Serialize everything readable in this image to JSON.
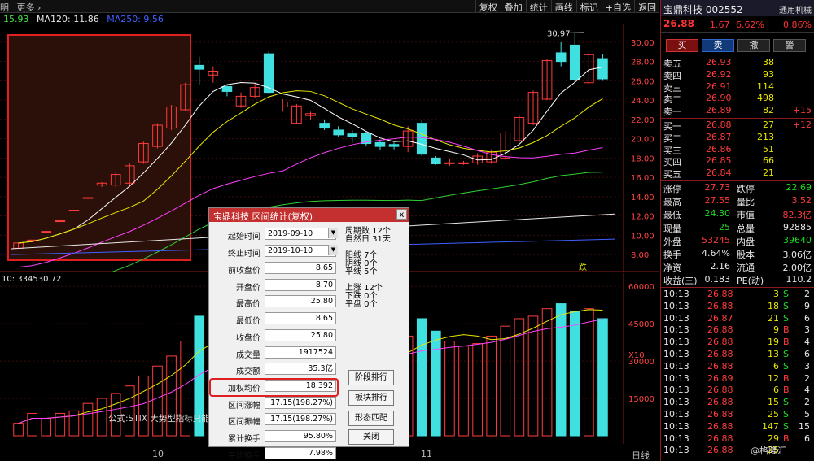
{
  "topbar": {
    "left": [
      "明",
      "更多 ›"
    ],
    "buttons": [
      "复权",
      "叠加",
      "统计",
      "画线",
      "标记",
      "+自选",
      "返回"
    ]
  },
  "ma_legend": [
    {
      "text": "15.93",
      "color": "#3fe03f"
    },
    {
      "text": "MA120: 11.86",
      "color": "#e8e8e8"
    },
    {
      "text": "MA250: 9.56",
      "color": "#4060ff"
    }
  ],
  "price_axis": [
    "30.00",
    "28.00",
    "26.00",
    "24.00",
    "22.00",
    "20.00",
    "18.00",
    "16.00",
    "14.00",
    "12.00",
    "10.00",
    "8.00"
  ],
  "price_annotation": "30.97",
  "vol_label": "10: 334530.72",
  "vol_axis": [
    "60000",
    "45000",
    "30000",
    "15000",
    "X10"
  ],
  "up_marker": "跌",
  "bottom_axis": {
    "left": "10",
    "mid": "11",
    "right": "日线"
  },
  "chart_data": {
    "type": "candlestick",
    "candles": [
      {
        "o": 8.65,
        "c": 9.2,
        "h": 9.2,
        "l": 8.65
      },
      {
        "o": 9.5,
        "c": 9.5,
        "h": 9.5,
        "l": 9.5
      },
      {
        "o": 10.4,
        "c": 10.4,
        "h": 10.4,
        "l": 10.4
      },
      {
        "o": 11.5,
        "c": 11.5,
        "h": 11.5,
        "l": 11.5
      },
      {
        "o": 12.6,
        "c": 12.6,
        "h": 12.6,
        "l": 12.6
      },
      {
        "o": 13.9,
        "c": 13.9,
        "h": 13.9,
        "l": 13.9
      },
      {
        "o": 15.2,
        "c": 15.4,
        "h": 15.5,
        "l": 15.0
      },
      {
        "o": 15.2,
        "c": 16.3,
        "h": 16.5,
        "l": 15.0
      },
      {
        "o": 15.4,
        "c": 17.2,
        "h": 17.5,
        "l": 15.0
      },
      {
        "o": 17.6,
        "c": 19.5,
        "h": 19.7,
        "l": 17.4
      },
      {
        "o": 19.2,
        "c": 21.4,
        "h": 21.6,
        "l": 19.0
      },
      {
        "o": 21.1,
        "c": 23.3,
        "h": 23.5,
        "l": 20.9
      },
      {
        "o": 23.0,
        "c": 25.6,
        "h": 25.8,
        "l": 22.9
      },
      {
        "o": 27.6,
        "c": 27.2,
        "h": 28.5,
        "l": 25.6
      },
      {
        "o": 26.6,
        "c": 27.0,
        "h": 27.5,
        "l": 25.8
      },
      {
        "o": 25.4,
        "c": 24.9,
        "h": 25.6,
        "l": 24.4
      },
      {
        "o": 23.4,
        "c": 24.4,
        "h": 24.8,
        "l": 23.2
      },
      {
        "o": 24.4,
        "c": 25.3,
        "h": 25.7,
        "l": 24.2
      },
      {
        "o": 28.8,
        "c": 24.8,
        "h": 29.0,
        "l": 24.6
      },
      {
        "o": 23.3,
        "c": 23.8,
        "h": 24.1,
        "l": 22.8
      },
      {
        "o": 21.6,
        "c": 23.4,
        "h": 23.6,
        "l": 21.5
      },
      {
        "o": 22.4,
        "c": 22.6,
        "h": 22.8,
        "l": 22.0
      },
      {
        "o": 21.6,
        "c": 21.1,
        "h": 22.0,
        "l": 20.9
      },
      {
        "o": 20.9,
        "c": 20.4,
        "h": 21.3,
        "l": 20.2
      },
      {
        "o": 20.5,
        "c": 20.2,
        "h": 20.9,
        "l": 19.6
      },
      {
        "o": 20.6,
        "c": 19.5,
        "h": 20.8,
        "l": 19.2
      },
      {
        "o": 19.6,
        "c": 19.2,
        "h": 19.9,
        "l": 18.8
      },
      {
        "o": 19.4,
        "c": 19.2,
        "h": 19.6,
        "l": 18.9
      },
      {
        "o": 19.2,
        "c": 20.8,
        "h": 21.3,
        "l": 18.6
      },
      {
        "o": 21.6,
        "c": 18.4,
        "h": 22.0,
        "l": 18.2
      },
      {
        "o": 18.0,
        "c": 17.4,
        "h": 18.2,
        "l": 17.3
      },
      {
        "o": 17.5,
        "c": 17.5,
        "h": 17.9,
        "l": 17.2
      },
      {
        "o": 17.4,
        "c": 17.5,
        "h": 17.7,
        "l": 17.3
      },
      {
        "o": 17.5,
        "c": 18.2,
        "h": 18.5,
        "l": 17.3
      },
      {
        "o": 17.6,
        "c": 18.6,
        "h": 18.9,
        "l": 17.4
      },
      {
        "o": 18.0,
        "c": 20.6,
        "h": 20.8,
        "l": 17.8
      },
      {
        "o": 19.8,
        "c": 22.2,
        "h": 22.4,
        "l": 19.6
      },
      {
        "o": 21.6,
        "c": 24.8,
        "h": 25.0,
        "l": 21.4
      },
      {
        "o": 24.1,
        "c": 28.1,
        "h": 28.3,
        "l": 24.0
      },
      {
        "o": 28.9,
        "c": 28.0,
        "h": 30.0,
        "l": 27.5
      },
      {
        "o": 29.7,
        "c": 26.1,
        "h": 30.97,
        "l": 25.8
      },
      {
        "o": 25.8,
        "c": 28.7,
        "h": 29.0,
        "l": 25.5
      },
      {
        "o": 28.3,
        "c": 26.2,
        "h": 28.8,
        "l": 26.0
      }
    ],
    "volume": [
      5000,
      9000,
      7000,
      9000,
      10000,
      13000,
      15000,
      17000,
      20000,
      24000,
      28000,
      32000,
      38000,
      48000,
      40000,
      42000,
      38000,
      36000,
      46000,
      34000,
      36000,
      30000,
      31000,
      30000,
      32000,
      32000,
      31000,
      32000,
      40000,
      47000,
      42000,
      38000,
      36000,
      37000,
      40000,
      44000,
      47000,
      48000,
      51000,
      53000,
      50000,
      51000,
      47000
    ],
    "ylim": [
      7.0,
      31.0
    ],
    "vol_ylim": [
      0,
      62000
    ]
  },
  "dialog": {
    "title": "宝鼎科技 区间统计(复权)",
    "close": "x",
    "start_label": "起始时间",
    "start": "2019-09-10",
    "end_label": "终止时间",
    "end": "2019-10-10",
    "rows": [
      {
        "label": "前收盘价",
        "value": "8.65"
      },
      {
        "label": "开盘价",
        "value": "8.70"
      },
      {
        "label": "最高价",
        "value": "25.80"
      },
      {
        "label": "最低价",
        "value": "8.65"
      },
      {
        "label": "收盘价",
        "value": "25.80"
      },
      {
        "label": "成交量",
        "value": "1917524"
      },
      {
        "label": "成交额",
        "value": "35.3亿"
      },
      {
        "label": "加权均价",
        "value": "18.392"
      },
      {
        "label": "区间涨幅",
        "value": "17.15(198.27%)"
      },
      {
        "label": "区间振幅",
        "value": "17.15(198.27%)"
      },
      {
        "label": "累计换手",
        "value": "95.80%"
      },
      {
        "label": "平均换手",
        "value": "7.98%"
      }
    ],
    "stats": [
      "周期数 12个",
      "自然日 31天",
      "阳线 7个",
      "阴线 0个",
      "平线 5个",
      "上涨 12个",
      "下跌 0个",
      "平盘 0个"
    ],
    "buttons": [
      "阶段排行",
      "板块排行",
      "形态匹配",
      "关闭"
    ]
  },
  "formula": "公式:STIX 大势型指标只能用",
  "right": {
    "name": "宝鼎科技 002552",
    "sector": "通用机械",
    "price": "26.88",
    "change": "1.67",
    "pct": "6.62%",
    "other_pct": "0.86%",
    "trade_buttons": [
      "买",
      "卖",
      "撤",
      "警"
    ],
    "asks": [
      {
        "l": "卖五",
        "p": "26.93",
        "v": "38",
        "d": ""
      },
      {
        "l": "卖四",
        "p": "26.92",
        "v": "93",
        "d": ""
      },
      {
        "l": "卖三",
        "p": "26.91",
        "v": "114",
        "d": ""
      },
      {
        "l": "卖二",
        "p": "26.90",
        "v": "498",
        "d": ""
      },
      {
        "l": "卖一",
        "p": "26.89",
        "v": "82",
        "d": "+15"
      }
    ],
    "bids": [
      {
        "l": "买一",
        "p": "26.88",
        "v": "27",
        "d": "+12"
      },
      {
        "l": "买二",
        "p": "26.87",
        "v": "213",
        "d": ""
      },
      {
        "l": "买三",
        "p": "26.86",
        "v": "51",
        "d": ""
      },
      {
        "l": "买四",
        "p": "26.85",
        "v": "66",
        "d": ""
      },
      {
        "l": "买五",
        "p": "26.84",
        "v": "21",
        "d": ""
      }
    ],
    "quote": [
      [
        "涨停",
        "27.73",
        "跌停",
        "22.69"
      ],
      [
        "最高",
        "27.55",
        "量比",
        "3.52"
      ],
      [
        "最低",
        "24.30",
        "市值",
        "82.3亿"
      ],
      [
        "现量",
        "25",
        "总量",
        "92885"
      ],
      [
        "外盘",
        "53245",
        "内盘",
        "39640"
      ],
      [
        "换手",
        "4.64%",
        "股本",
        "3.06亿"
      ],
      [
        "净资",
        "2.16",
        "流通",
        "2.00亿"
      ],
      [
        "收益(三)",
        "0.183",
        "PE(动)",
        "110.2"
      ]
    ],
    "ticks": [
      [
        "10:13",
        "26.88",
        "3",
        "S",
        "2"
      ],
      [
        "10:13",
        "26.88",
        "18",
        "S",
        "9"
      ],
      [
        "10:13",
        "26.87",
        "21",
        "S",
        "6"
      ],
      [
        "10:13",
        "26.88",
        "9",
        "B",
        "3"
      ],
      [
        "10:13",
        "26.88",
        "19",
        "B",
        "4"
      ],
      [
        "10:13",
        "26.88",
        "13",
        "S",
        "6"
      ],
      [
        "10:13",
        "26.88",
        "6",
        "S",
        "3"
      ],
      [
        "10:13",
        "26.89",
        "12",
        "B",
        "2"
      ],
      [
        "10:13",
        "26.88",
        "6",
        "B",
        "4"
      ],
      [
        "10:13",
        "26.88",
        "15",
        "S",
        "2"
      ],
      [
        "10:13",
        "26.88",
        "25",
        "S",
        "5"
      ],
      [
        "10:13",
        "26.88",
        "147",
        "S",
        "15"
      ],
      [
        "10:13",
        "26.88",
        "29",
        "B",
        "6"
      ],
      [
        "10:13",
        "26.88",
        "25",
        "",
        ""
      ]
    ]
  },
  "watermark": "@格隆汇"
}
